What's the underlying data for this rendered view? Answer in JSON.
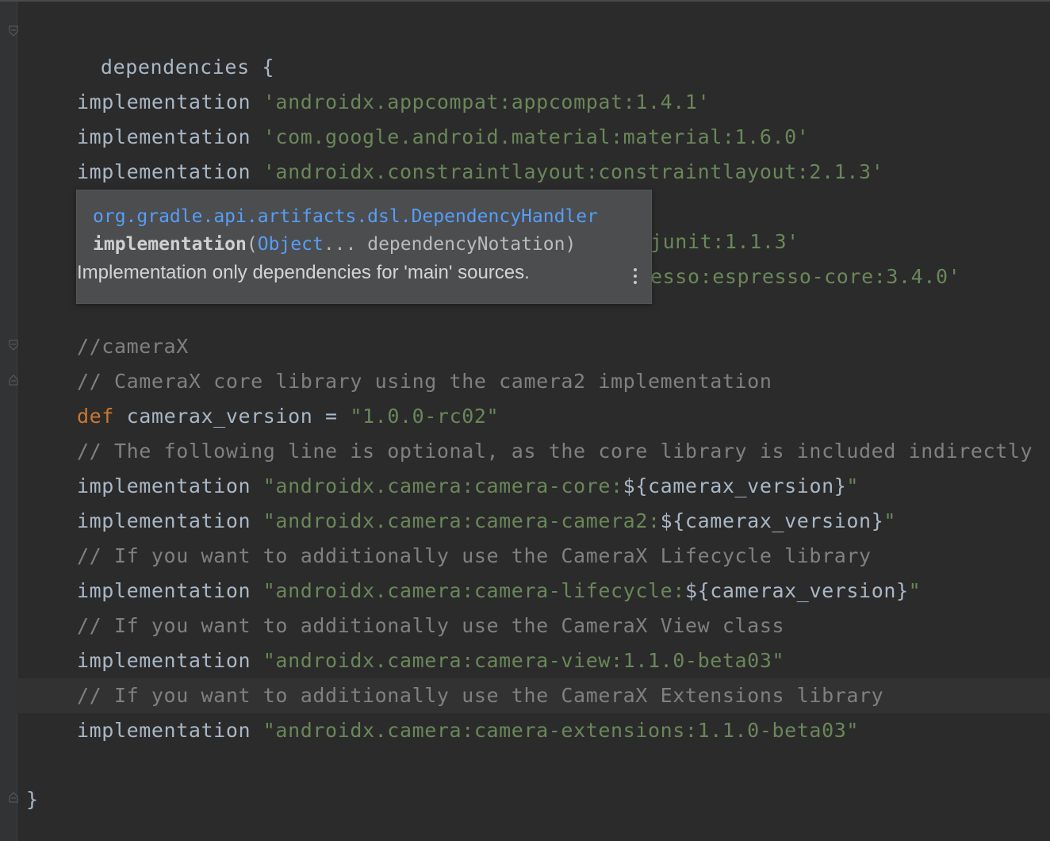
{
  "colors": {
    "background": "#2b2b2b",
    "keyword": "#cc7832",
    "string": "#6a8759",
    "comment": "#808080",
    "text": "#a9b7c6",
    "link": "#589df6"
  },
  "editor": {
    "lines": [
      {
        "plain": "dependencies {"
      },
      {
        "kw": "implementation",
        "str": "'androidx.appcompat:appcompat:1.4.1'"
      },
      {
        "kw": "implementation",
        "str": "'com.google.android.material:material:1.6.0'"
      },
      {
        "kw": "implementation",
        "str": "'androidx.constraintlayout:constraintlayout:2.1.3'"
      },
      {
        "str": "junit:1.1.3'"
      },
      {
        "str": "esso:espresso-core:3.4.0'"
      },
      {
        "comment": "//cameraX"
      },
      {
        "comment": "// CameraX core library using the camera2 implementation"
      },
      {
        "kw": "def",
        "plain": "camerax_version = ",
        "str": "\"1.0.0-rc02\""
      },
      {
        "comment": "// The following line is optional, as the core library is included indirectly"
      },
      {
        "kw": "implementation",
        "str": "\"androidx.camera:camera-core:",
        "interp": "${camerax_version}",
        "str_end": "\""
      },
      {
        "kw": "implementation",
        "str": "\"androidx.camera:camera-camera2:",
        "interp": "${camerax_version}",
        "str_end": "\""
      },
      {
        "comment": "// If you want to additionally use the CameraX Lifecycle library"
      },
      {
        "kw": "implementation",
        "str": "\"androidx.camera:camera-lifecycle:",
        "interp": "${camerax_version}",
        "str_end": "\""
      },
      {
        "comment": "// If you want to additionally use the CameraX View class"
      },
      {
        "kw": "implementation",
        "str": "\"androidx.camera:camera-view:1.1.0-beta03\""
      },
      {
        "comment": "// If you want to additionally use the CameraX Extensions library"
      },
      {
        "kw": "implementation",
        "str": "\"androidx.camera:camera-extensions:1.1.0-beta03\""
      },
      {
        "plain": "}"
      }
    ]
  },
  "popup": {
    "package": "org.gradle.api.artifacts.dsl.DependencyHandler",
    "function": "implementation",
    "open_paren": "(",
    "param_type": "Object",
    "param_rest": "... dependencyNotation)",
    "description": "Implementation only dependencies for 'main' sources.",
    "more_icon": "vertical-ellipsis-icon"
  }
}
